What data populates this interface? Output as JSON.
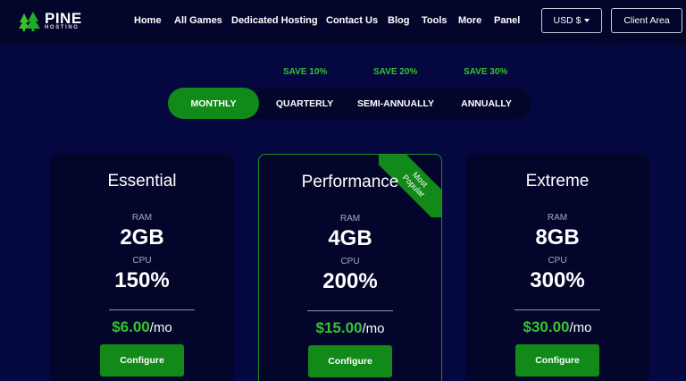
{
  "brand": {
    "name": "PINE",
    "sub": "HOSTING"
  },
  "nav": {
    "items": [
      "Home",
      "All Games",
      "Dedicated Hosting",
      "Contact Us",
      "Blog",
      "Tools",
      "More",
      "Panel"
    ],
    "currency": "USD $",
    "client_area": "Client Area"
  },
  "billing": {
    "save_labels": [
      "SAVE 10%",
      "SAVE 20%",
      "SAVE 30%"
    ],
    "options": [
      "MONTHLY",
      "QUARTERLY",
      "SEMI-ANNUALLY",
      "ANNUALLY"
    ],
    "active": "MONTHLY"
  },
  "plans": [
    {
      "name": "Essential",
      "ram_label": "RAM",
      "ram": "2GB",
      "cpu_label": "CPU",
      "cpu": "150%",
      "price": "$6.00",
      "unit": "/mo",
      "button": "Configure"
    },
    {
      "name": "Performance",
      "ram_label": "RAM",
      "ram": "4GB",
      "cpu_label": "CPU",
      "cpu": "200%",
      "price": "$15.00",
      "unit": "/mo",
      "button": "Configure",
      "ribbon_line1": "Most",
      "ribbon_line2": "Popular"
    },
    {
      "name": "Extreme",
      "ram_label": "RAM",
      "ram": "8GB",
      "cpu_label": "CPU",
      "cpu": "300%",
      "price": "$30.00",
      "unit": "/mo",
      "button": "Configure"
    }
  ],
  "colors": {
    "background": "#050740",
    "panel": "#03062a",
    "accent_green": "#118a1a",
    "price_green": "#37c232"
  },
  "icons": {
    "logo": "pine-trees-icon",
    "currency_caret": "caret-down-icon"
  }
}
